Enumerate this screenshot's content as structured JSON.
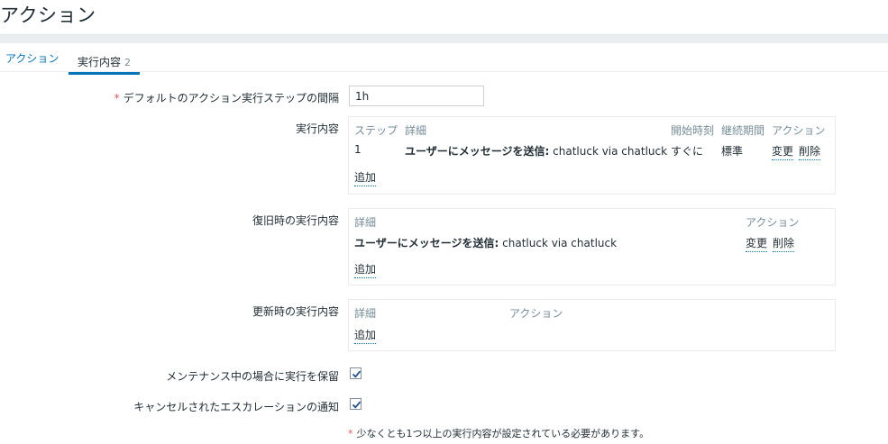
{
  "page": {
    "title": "アクション"
  },
  "tabs": [
    {
      "label": "アクション"
    },
    {
      "label": "実行内容",
      "count": "2"
    }
  ],
  "form": {
    "interval": {
      "required_mark": "*",
      "label": "デフォルトのアクション実行ステップの間隔",
      "value": "1h"
    },
    "operations": {
      "label": "実行内容",
      "headers": {
        "steps": "ステップ",
        "details": "詳細",
        "start_in": "開始時刻",
        "duration": "継続期間",
        "action": "アクション"
      },
      "rows": [
        {
          "step": "1",
          "details_bold": "ユーザーにメッセージを送信:",
          "details_rest": " chatluck via chatluck",
          "start_in": "すぐに",
          "duration": "標準",
          "edit": "変更",
          "remove": "削除"
        }
      ],
      "add": "追加"
    },
    "recovery": {
      "label": "復旧時の実行内容",
      "headers": {
        "details": "詳細",
        "action": "アクション"
      },
      "rows": [
        {
          "details_bold": "ユーザーにメッセージを送信:",
          "details_rest": " chatluck via chatluck",
          "edit": "変更",
          "remove": "削除"
        }
      ],
      "add": "追加"
    },
    "update": {
      "label": "更新時の実行内容",
      "headers": {
        "details": "詳細",
        "action": "アクション"
      },
      "add": "追加"
    },
    "pause_maintenance": {
      "label": "メンテナンス中の場合に実行を保留",
      "checked": true
    },
    "notify_cancelled": {
      "label": "キャンセルされたエスカレーションの通知",
      "checked": true
    },
    "note": {
      "required_mark": "*",
      "text": "少なくとも1つ以上の実行内容が設定されている必要があります。"
    }
  },
  "colors": {
    "link": "#0275b8",
    "required": "#e45959",
    "header_text": "#768d99"
  },
  "icons": {
    "checkbox": "checkmark-icon"
  }
}
